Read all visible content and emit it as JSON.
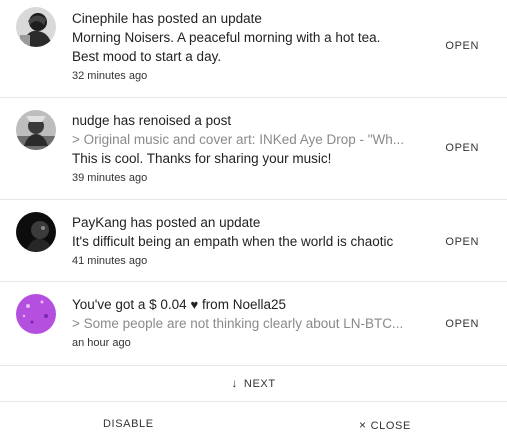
{
  "notifications": [
    {
      "avatar_icon": "user-avatar-cinephile",
      "lines": [
        "Cinephile has posted an update",
        "Morning Noisers. A peaceful morning with a hot tea.",
        "Best mood to start a day."
      ],
      "time": "32 minutes ago",
      "action": "OPEN"
    },
    {
      "avatar_icon": "user-avatar-nudge",
      "title": "nudge has renoised a post",
      "quote": "> Original music and cover art: INKed Aye Drop - \"Wh...",
      "text": "This is cool. Thanks for sharing your music!",
      "time": "39 minutes ago",
      "action": "OPEN"
    },
    {
      "avatar_icon": "user-avatar-paykang",
      "title": "PayKang has posted an update",
      "text": "It's difficult being an empath when the world is chaotic",
      "time": "41 minutes ago",
      "action": "OPEN"
    },
    {
      "avatar_icon": "user-avatar-noella25",
      "title_prefix": "You've got a $ 0.04",
      "heart_icon": "heart-icon",
      "title_suffix": "from Noella25",
      "quote": "> Some people are not thinking clearly about LN-BTC...",
      "time": "an hour ago",
      "action": "OPEN"
    }
  ],
  "next": {
    "icon": "arrow-down-icon",
    "label": "NEXT"
  },
  "footer": {
    "disable_label": "DISABLE",
    "close_icon": "close-icon",
    "close_label": "CLOSE"
  },
  "colors": {
    "text": "#222222",
    "muted": "#8a8a8a",
    "divider": "#e6e6e6",
    "noella_avatar": "#b44fe0"
  }
}
